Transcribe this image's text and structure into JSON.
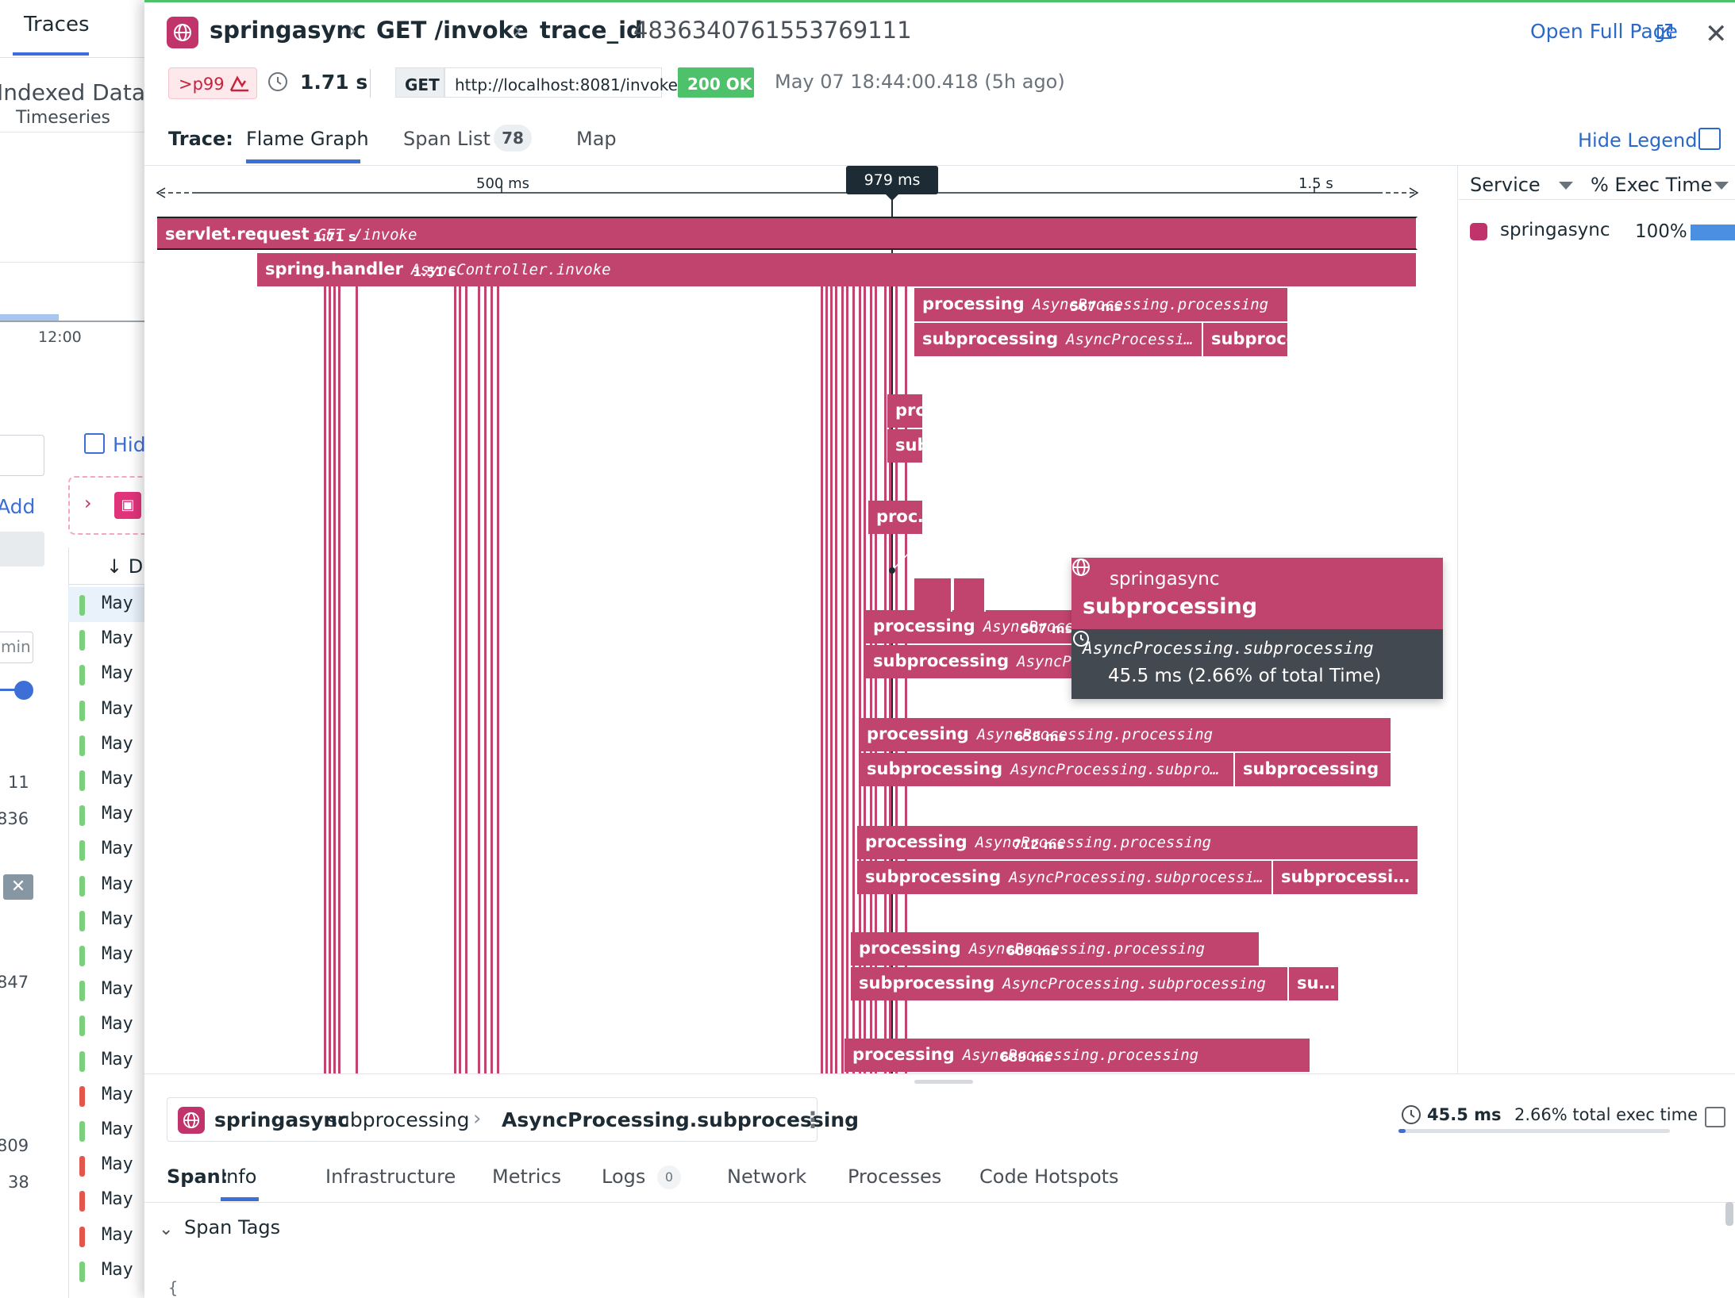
{
  "background": {
    "tab_label": "Traces",
    "indexed_label": "Indexed Data",
    "timeseries_label": "Timeseries",
    "axis_time": "12:00",
    "hide_label": "Hide",
    "add_label": "Add",
    "col_header": "D",
    "min_placeholder": "min",
    "numbers": [
      "11",
      "836",
      "847",
      "809",
      "38"
    ],
    "rows": [
      {
        "date": "May",
        "status": "ok"
      },
      {
        "date": "May",
        "status": "ok"
      },
      {
        "date": "May",
        "status": "ok"
      },
      {
        "date": "May",
        "status": "ok"
      },
      {
        "date": "May",
        "status": "ok"
      },
      {
        "date": "May",
        "status": "ok"
      },
      {
        "date": "May",
        "status": "ok"
      },
      {
        "date": "May",
        "status": "ok"
      },
      {
        "date": "May",
        "status": "ok"
      },
      {
        "date": "May",
        "status": "ok"
      },
      {
        "date": "May",
        "status": "ok"
      },
      {
        "date": "May",
        "status": "ok"
      },
      {
        "date": "May",
        "status": "ok"
      },
      {
        "date": "May",
        "status": "ok"
      },
      {
        "date": "May",
        "status": "error"
      },
      {
        "date": "May",
        "status": "ok"
      },
      {
        "date": "May",
        "status": "error"
      },
      {
        "date": "May",
        "status": "error"
      },
      {
        "date": "May",
        "status": "error"
      },
      {
        "date": "May",
        "status": "ok"
      }
    ]
  },
  "header": {
    "service": "springasync",
    "resource": "GET /invoke",
    "trace_id_label": "trace_id",
    "trace_id": "4836340761553769111",
    "open_full_page": "Open Full Page",
    "percentile": ">p99",
    "duration": "1.71 s",
    "method": "GET",
    "url": "http://localhost:8081/invoke",
    "status": "200 OK",
    "timestamp": "May 07 18:44:00.418 (5h ago)"
  },
  "tabs": {
    "trace_label": "Trace:",
    "flame_graph": "Flame Graph",
    "span_list": "Span List",
    "span_list_count": "78",
    "map": "Map",
    "hide_legend": "Hide Legend"
  },
  "legend": {
    "service_header": "Service",
    "exec_header": "% Exec Time",
    "items": [
      {
        "name": "springasync",
        "pct": "100%",
        "color": "#c1336b"
      }
    ]
  },
  "timeline": {
    "cursor": "979 ms",
    "ticks": [
      "500 ms",
      "1.5 s"
    ]
  },
  "spans": [
    {
      "op": "servlet.request",
      "res": "GET /invoke",
      "dur": "1.71 s"
    },
    {
      "op": "spring.handler",
      "res": "AsyncController.invoke",
      "dur": "1.51 s"
    },
    {
      "op": "processing",
      "res": "AsyncProcessing.processing",
      "dur": "567 ms"
    },
    {
      "op": "subprocessing",
      "res": "AsyncProcessi…",
      "dur": ""
    },
    {
      "op": "subprocessing",
      "res": "…",
      "dur": ""
    },
    {
      "op": "proc",
      "res": "",
      "dur": ""
    },
    {
      "op": "sub",
      "res": "",
      "dur": ""
    },
    {
      "op": "proc…",
      "res": "",
      "dur": ""
    },
    {
      "op": "processing",
      "res": "AsyncProcessing.processing",
      "dur": "507 ms"
    },
    {
      "op": "subprocessing",
      "res": "AsyncProcessing.subproc…",
      "dur": ""
    },
    {
      "op": "processing",
      "res": "AsyncProcessing.processing",
      "dur": "658 ms"
    },
    {
      "op": "subprocessing",
      "res": "AsyncProcessing.subpro…",
      "dur": ""
    },
    {
      "op": "subprocessing",
      "res": "",
      "dur": ""
    },
    {
      "op": "processing",
      "res": "AsyncProcessing.processing",
      "dur": "712 ms"
    },
    {
      "op": "subprocessing",
      "res": "AsyncProcessing.subprocessi…",
      "dur": ""
    },
    {
      "op": "subprocessi…",
      "res": "",
      "dur": ""
    },
    {
      "op": "processing",
      "res": "AsyncProcessing.processing",
      "dur": "609 ms"
    },
    {
      "op": "subprocessing",
      "res": "AsyncProcessing.subprocessing",
      "dur": ""
    },
    {
      "op": "su…",
      "res": "",
      "dur": ""
    },
    {
      "op": "processing",
      "res": "AsyncProcessing.processing",
      "dur": "689 ms"
    }
  ],
  "tooltip": {
    "service": "springasync",
    "operation": "subprocessing",
    "resource": "AsyncProcessing.subprocessing",
    "duration": "45.5 ms (2.66% of total Time)"
  },
  "span_detail": {
    "service": "springasync",
    "operation": "subprocessing",
    "resource": "AsyncProcessing.subprocessing",
    "duration": "45.5 ms",
    "exec_time": "2.66% total exec time",
    "exec_fraction": 0.0266,
    "span_label": "Span:",
    "tabs": [
      "Info",
      "Infrastructure",
      "Metrics",
      "Logs",
      "Network",
      "Processes",
      "Code Hotspots"
    ],
    "logs_count": "0",
    "span_tags": "Span Tags",
    "brace": "{"
  },
  "colors": {
    "span": "#c1446e",
    "accent": "#3d6fd6",
    "ok": "#4ec26a",
    "error": "#e3564b"
  }
}
